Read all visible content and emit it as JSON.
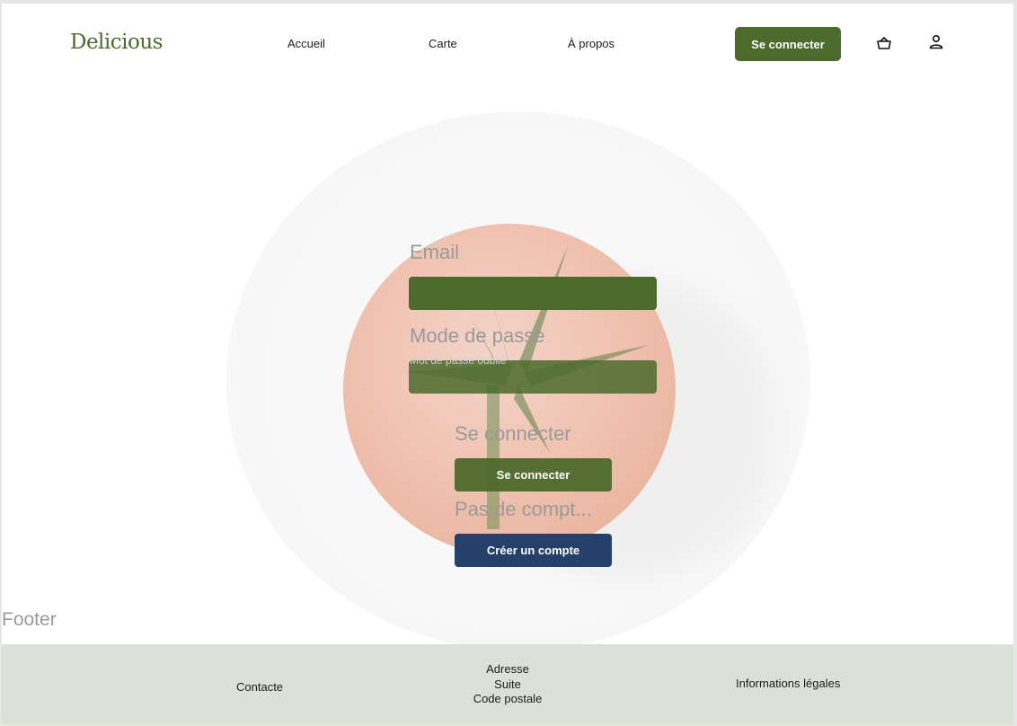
{
  "header": {
    "logo": "Delicious",
    "nav": [
      "Accueil",
      "Carte",
      "À propos"
    ],
    "login_button": "Se connecter",
    "icons": [
      "basket-icon",
      "user-icon"
    ]
  },
  "form": {
    "email_label": "Email",
    "password_label": "Mode de passe",
    "forgot_password": "Mot de passe oublié",
    "login_heading": "Se connecter",
    "login_button": "Se connecter",
    "no_account_heading": "Pas de compt...",
    "create_account_button": "Créer un compte"
  },
  "footer": {
    "title": "Footer",
    "contact": "Contacte",
    "address": [
      "Adresse",
      "Suite",
      "Code postale"
    ],
    "legal": "Informations légales"
  },
  "colors": {
    "primary_green": "#4b6a2b",
    "navy": "#25406b",
    "footer_bg": "#dbe1d6"
  }
}
